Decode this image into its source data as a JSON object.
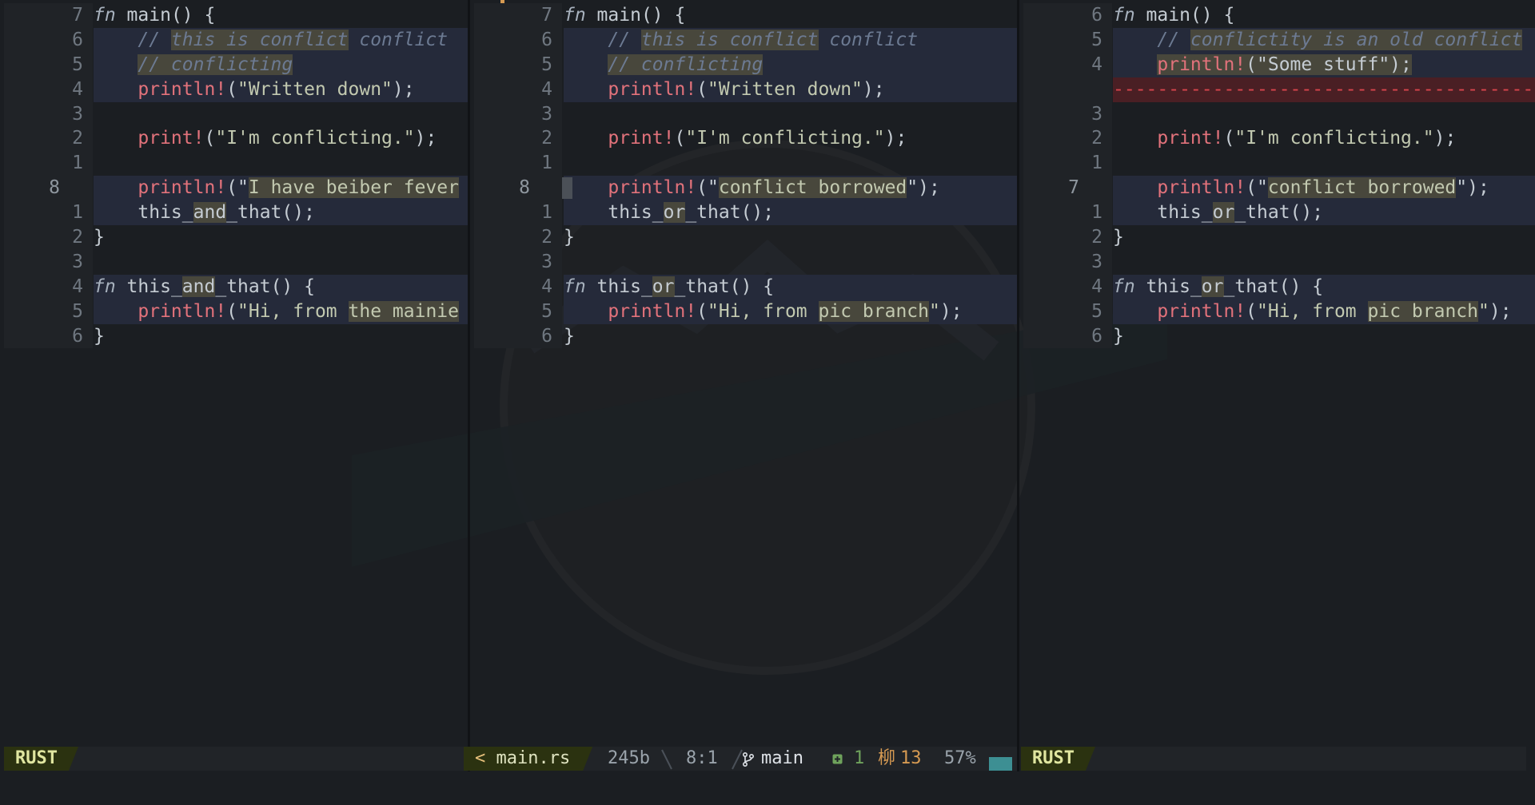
{
  "panes": {
    "left": {
      "lines": [
        {
          "num": "7",
          "cur": "",
          "parts": [
            [
              "kw",
              "fn"
            ],
            [
              "",
              ""
            ],
            [
              "",
              " main() {"
            ]
          ],
          "diff": false
        },
        {
          "num": "6",
          "cur": "",
          "parts": [
            [
              "",
              "    "
            ],
            [
              "cm",
              "// "
            ],
            [
              "cm hl",
              "this is conflict"
            ],
            [
              "cm",
              " conflict "
            ]
          ],
          "diff": true
        },
        {
          "num": "5",
          "cur": "",
          "parts": [
            [
              "",
              "    "
            ],
            [
              "cm hl",
              "// conflicting"
            ]
          ],
          "diff": true
        },
        {
          "num": "4",
          "cur": "",
          "parts": [
            [
              "",
              "    "
            ],
            [
              "mac",
              "println!"
            ],
            [
              "",
              "("
            ],
            [
              "str",
              "\"Written down\""
            ],
            [
              "",
              ");"
            ]
          ],
          "diff": true
        },
        {
          "num": "3",
          "cur": "",
          "parts": [],
          "diff": false
        },
        {
          "num": "2",
          "cur": "",
          "parts": [
            [
              "",
              "    "
            ],
            [
              "mac",
              "print!"
            ],
            [
              "",
              "("
            ],
            [
              "str",
              "\"I'm conflicting.\""
            ],
            [
              "",
              ");"
            ]
          ],
          "diff": false
        },
        {
          "num": "1",
          "cur": "",
          "parts": [],
          "diff": false
        },
        {
          "num": "",
          "cur": "8",
          "parts": [
            [
              "",
              "    "
            ],
            [
              "mac",
              "println!"
            ],
            [
              "",
              "(\""
            ],
            [
              "str hl",
              "I have beiber fever"
            ]
          ],
          "diff": true
        },
        {
          "num": "1",
          "cur": "",
          "parts": [
            [
              "",
              "    this_"
            ],
            [
              "hl",
              "and"
            ],
            [
              "",
              "_that();"
            ]
          ],
          "diff": true
        },
        {
          "num": "2",
          "cur": "",
          "parts": [
            [
              "",
              "}"
            ]
          ],
          "diff": false
        },
        {
          "num": "3",
          "cur": "",
          "parts": [],
          "diff": false
        },
        {
          "num": "4",
          "cur": "",
          "parts": [
            [
              "kw",
              "fn"
            ],
            [
              "",
              " this_"
            ],
            [
              "hl",
              "and"
            ],
            [
              "",
              "_that() {"
            ]
          ],
          "diff": true
        },
        {
          "num": "5",
          "cur": "",
          "parts": [
            [
              "",
              "    "
            ],
            [
              "mac",
              "println!"
            ],
            [
              "",
              "("
            ],
            [
              "str",
              "\"Hi, from "
            ],
            [
              "str hl",
              "the mainie"
            ]
          ],
          "diff": true
        },
        {
          "num": "6",
          "cur": "",
          "parts": [
            [
              "",
              "}"
            ]
          ],
          "diff": false
        }
      ]
    },
    "middle": {
      "lines": [
        {
          "num": "7",
          "cur": "",
          "parts": [
            [
              "kw",
              "fn"
            ],
            [
              "",
              " main() {"
            ]
          ],
          "diff": false
        },
        {
          "num": "6",
          "cur": "",
          "parts": [
            [
              "",
              "    "
            ],
            [
              "cm",
              "// "
            ],
            [
              "cm hl",
              "this is conflict"
            ],
            [
              "cm",
              " conflict"
            ]
          ],
          "diff": true
        },
        {
          "num": "5",
          "cur": "",
          "parts": [
            [
              "",
              "    "
            ],
            [
              "cm hl",
              "// conflicting"
            ]
          ],
          "diff": true
        },
        {
          "num": "4",
          "cur": "",
          "parts": [
            [
              "",
              "    "
            ],
            [
              "mac",
              "println!"
            ],
            [
              "",
              "("
            ],
            [
              "str",
              "\"Written down\""
            ],
            [
              "",
              ");"
            ]
          ],
          "diff": true
        },
        {
          "num": "3",
          "cur": "",
          "parts": [],
          "diff": false
        },
        {
          "num": "2",
          "cur": "",
          "parts": [
            [
              "",
              "    "
            ],
            [
              "mac",
              "print!"
            ],
            [
              "",
              "("
            ],
            [
              "str",
              "\"I'm conflicting.\""
            ],
            [
              "",
              ");"
            ]
          ],
          "diff": false
        },
        {
          "num": "1",
          "cur": "",
          "parts": [],
          "diff": false
        },
        {
          "num": "",
          "cur": "8",
          "parts": [
            [
              "",
              "    "
            ],
            [
              "mac",
              "println!"
            ],
            [
              "",
              "(\""
            ],
            [
              "str hl",
              "conflict borrowed"
            ],
            [
              "",
              "\");"
            ]
          ],
          "diff": true
        },
        {
          "num": "1",
          "cur": "",
          "parts": [
            [
              "",
              "    this_"
            ],
            [
              "hl",
              "or"
            ],
            [
              "",
              "_that();"
            ]
          ],
          "diff": true
        },
        {
          "num": "2",
          "cur": "",
          "parts": [
            [
              "",
              "}"
            ]
          ],
          "diff": false
        },
        {
          "num": "3",
          "cur": "",
          "parts": [],
          "diff": false
        },
        {
          "num": "4",
          "cur": "",
          "parts": [
            [
              "kw",
              "fn"
            ],
            [
              "",
              " this_"
            ],
            [
              "hl",
              "or"
            ],
            [
              "",
              "_that() {"
            ]
          ],
          "diff": true
        },
        {
          "num": "5",
          "cur": "",
          "parts": [
            [
              "",
              "    "
            ],
            [
              "mac",
              "println!"
            ],
            [
              "",
              "("
            ],
            [
              "str",
              "\"Hi, from "
            ],
            [
              "str hl",
              "pic branch"
            ],
            [
              "str",
              "\""
            ],
            [
              "",
              ");"
            ]
          ],
          "diff": true
        },
        {
          "num": "6",
          "cur": "",
          "parts": [
            [
              "",
              "}"
            ]
          ],
          "diff": false
        }
      ]
    },
    "right": {
      "lines": [
        {
          "num": "6",
          "cur": "",
          "parts": [
            [
              "kw",
              "fn"
            ],
            [
              "",
              " main() {"
            ]
          ],
          "diff": false
        },
        {
          "num": "5",
          "cur": "",
          "parts": [
            [
              "",
              "    "
            ],
            [
              "cm",
              "// "
            ],
            [
              "cm hl",
              "conflictity is an old conflict"
            ]
          ],
          "diff": true
        },
        {
          "num": "4",
          "cur": "",
          "parts": [
            [
              "",
              "    "
            ],
            [
              "mac hl",
              "println!"
            ],
            [
              "hl",
              "(\"Some stuff\");"
            ]
          ],
          "diff": true
        },
        {
          "num": "",
          "cur": "",
          "parts": [
            [
              "dash",
              "--------------------------------------------"
            ]
          ],
          "diff": false,
          "del": true
        },
        {
          "num": "3",
          "cur": "",
          "parts": [],
          "diff": false
        },
        {
          "num": "2",
          "cur": "",
          "parts": [
            [
              "",
              "    "
            ],
            [
              "mac",
              "print!"
            ],
            [
              "",
              "("
            ],
            [
              "str",
              "\"I'm conflicting.\""
            ],
            [
              "",
              ");"
            ]
          ],
          "diff": false
        },
        {
          "num": "1",
          "cur": "",
          "parts": [],
          "diff": false
        },
        {
          "num": "",
          "cur": "7",
          "parts": [
            [
              "",
              "    "
            ],
            [
              "mac",
              "println!"
            ],
            [
              "",
              "(\""
            ],
            [
              "str hl",
              "conflict borrowed"
            ],
            [
              "",
              "\");"
            ]
          ],
          "diff": true
        },
        {
          "num": "1",
          "cur": "",
          "parts": [
            [
              "",
              "    this_"
            ],
            [
              "hl",
              "or"
            ],
            [
              "",
              "_that();"
            ]
          ],
          "diff": true
        },
        {
          "num": "2",
          "cur": "",
          "parts": [
            [
              "",
              "}"
            ]
          ],
          "diff": false
        },
        {
          "num": "3",
          "cur": "",
          "parts": [],
          "diff": false
        },
        {
          "num": "4",
          "cur": "",
          "parts": [
            [
              "kw",
              "fn"
            ],
            [
              "",
              " this_"
            ],
            [
              "hl",
              "or"
            ],
            [
              "",
              "_that() {"
            ]
          ],
          "diff": true
        },
        {
          "num": "5",
          "cur": "",
          "parts": [
            [
              "",
              "    "
            ],
            [
              "mac",
              "println!"
            ],
            [
              "",
              "("
            ],
            [
              "str",
              "\"Hi, from "
            ],
            [
              "str hl",
              "pic branch"
            ],
            [
              "str",
              "\""
            ],
            [
              "",
              ");"
            ]
          ],
          "diff": true
        },
        {
          "num": "6",
          "cur": "",
          "parts": [
            [
              "",
              "}"
            ]
          ],
          "diff": false
        }
      ]
    }
  },
  "status": {
    "left_mode": "RUST",
    "right_mode": "RUST",
    "file_arrow": "<",
    "file_name": "main.rs",
    "file_size": "245b",
    "position": "8:1",
    "branch_icon": "git-branch-icon",
    "branch": "main",
    "added_icon": "plus-square-icon",
    "added_count": "1",
    "changed_icon": "modified-icon",
    "changed_glyph": "柳",
    "changed_count": "13",
    "percent": "57%"
  },
  "colors": {
    "accent_yellow": "#e6c07b",
    "mode_bg": "#2b3210",
    "diff_bg": "#252a3a",
    "delete_bg": "#4a1f24",
    "scrollbar": "#3d8f93",
    "added": "#6fa35c"
  }
}
